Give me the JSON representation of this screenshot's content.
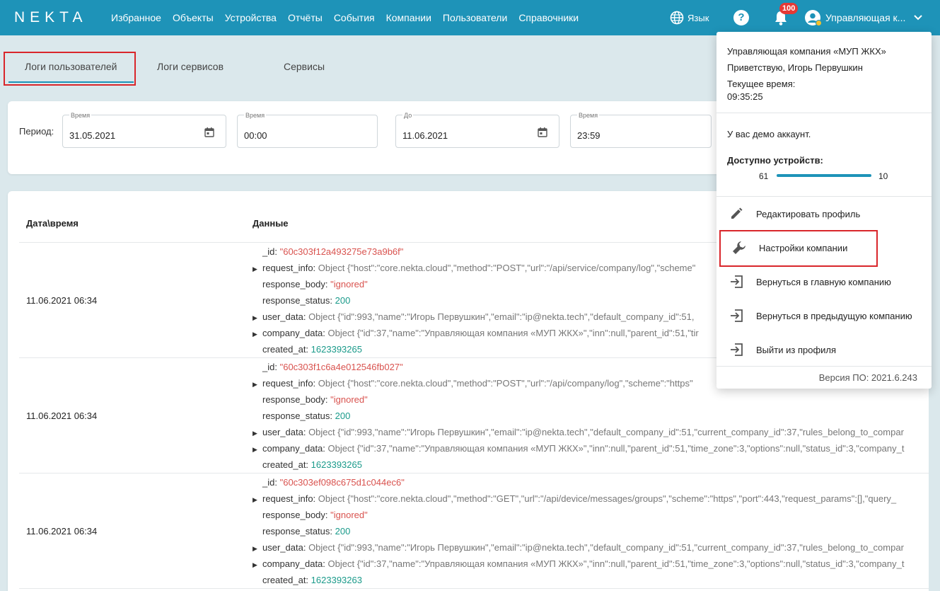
{
  "app": {
    "logo": "NEKTA",
    "nav": [
      "Избранное",
      "Объекты",
      "Устройства",
      "Отчёты",
      "События",
      "Компании",
      "Пользователи",
      "Справочники"
    ],
    "language_label": "Язык",
    "help_label": "?",
    "notifications_count": "100",
    "user_label": "Управляющая к..."
  },
  "tabs": [
    {
      "label": "Логи пользователей",
      "active": true
    },
    {
      "label": "Логи сервисов",
      "active": false
    },
    {
      "label": "Сервисы",
      "active": false
    }
  ],
  "filter": {
    "period_label": "Период:",
    "fields": [
      {
        "label": "Время",
        "value": "31.05.2021"
      },
      {
        "label": "Время",
        "value": "00:00"
      },
      {
        "label": "До",
        "value": "11.06.2021"
      },
      {
        "label": "Время",
        "value": "23:59"
      }
    ]
  },
  "table": {
    "headers": [
      "Дата\\время",
      "Данные"
    ],
    "rows": [
      {
        "date": "11.06.2021 06:34",
        "lines": [
          {
            "key": "_id:",
            "val": "\"60c303f12a493275e73a9b6f\"",
            "kind": "red",
            "arrow": false
          },
          {
            "key": "request_info:",
            "val": "Object {\"host\":\"core.nekta.cloud\",\"method\":\"POST\",\"url\":\"/api/service/company/log\",\"scheme\"",
            "kind": "grey",
            "arrow": true
          },
          {
            "key": "response_body:",
            "val": "\"ignored\"",
            "kind": "red",
            "arrow": false
          },
          {
            "key": "response_status:",
            "val": "200",
            "kind": "teal",
            "arrow": false
          },
          {
            "key": "user_data:",
            "val": "Object {\"id\":993,\"name\":\"Игорь Первушкин\",\"email\":\"ip@nekta.tech\",\"default_company_id\":51,",
            "kind": "grey",
            "arrow": true
          },
          {
            "key": "company_data:",
            "val": "Object {\"id\":37,\"name\":\"Управляющая компания «МУП ЖКХ»\",\"inn\":null,\"parent_id\":51,\"tir",
            "kind": "grey",
            "arrow": true
          },
          {
            "key": "created_at:",
            "val": "1623393265",
            "kind": "teal",
            "arrow": false
          }
        ]
      },
      {
        "date": "11.06.2021 06:34",
        "lines": [
          {
            "key": "_id:",
            "val": "\"60c303f1c6a4e012546fb027\"",
            "kind": "red",
            "arrow": false
          },
          {
            "key": "request_info:",
            "val": "Object {\"host\":\"core.nekta.cloud\",\"method\":\"POST\",\"url\":\"/api/company/log\",\"scheme\":\"https\"",
            "kind": "grey",
            "arrow": true
          },
          {
            "key": "response_body:",
            "val": "\"ignored\"",
            "kind": "red",
            "arrow": false
          },
          {
            "key": "response_status:",
            "val": "200",
            "kind": "teal",
            "arrow": false
          },
          {
            "key": "user_data:",
            "val": "Object {\"id\":993,\"name\":\"Игорь Первушкин\",\"email\":\"ip@nekta.tech\",\"default_company_id\":51,\"current_company_id\":37,\"rules_belong_to_compar",
            "kind": "grey",
            "arrow": true
          },
          {
            "key": "company_data:",
            "val": "Object {\"id\":37,\"name\":\"Управляющая компания «МУП ЖКХ»\",\"inn\":null,\"parent_id\":51,\"time_zone\":3,\"options\":null,\"status_id\":3,\"company_t",
            "kind": "grey",
            "arrow": true
          },
          {
            "key": "created_at:",
            "val": "1623393265",
            "kind": "teal",
            "arrow": false
          }
        ]
      },
      {
        "date": "11.06.2021 06:34",
        "lines": [
          {
            "key": "_id:",
            "val": "\"60c303ef098c675d1c044ec6\"",
            "kind": "red",
            "arrow": false
          },
          {
            "key": "request_info:",
            "val": "Object {\"host\":\"core.nekta.cloud\",\"method\":\"GET\",\"url\":\"/api/device/messages/groups\",\"scheme\":\"https\",\"port\":443,\"request_params\":[],\"query_",
            "kind": "grey",
            "arrow": true
          },
          {
            "key": "response_body:",
            "val": "\"ignored\"",
            "kind": "red",
            "arrow": false
          },
          {
            "key": "response_status:",
            "val": "200",
            "kind": "teal",
            "arrow": false
          },
          {
            "key": "user_data:",
            "val": "Object {\"id\":993,\"name\":\"Игорь Первушкин\",\"email\":\"ip@nekta.tech\",\"default_company_id\":51,\"current_company_id\":37,\"rules_belong_to_compar",
            "kind": "grey",
            "arrow": true
          },
          {
            "key": "company_data:",
            "val": "Object {\"id\":37,\"name\":\"Управляющая компания «МУП ЖКХ»\",\"inn\":null,\"parent_id\":51,\"time_zone\":3,\"options\":null,\"status_id\":3,\"company_t",
            "kind": "grey",
            "arrow": true
          },
          {
            "key": "created_at:",
            "val": "1623393263",
            "kind": "teal",
            "arrow": false
          }
        ]
      }
    ]
  },
  "profile_menu": {
    "company": "Управляющая компания «МУП ЖКХ»",
    "greeting": "Приветствую, Игорь Первушкин",
    "time_label": "Текущее время:",
    "time_value": "09:35:25",
    "demo_note": "У вас демо аккаунт.",
    "devices_label": "Доступно устройств:",
    "devices_left": "61",
    "devices_right": "10",
    "items": [
      {
        "label": "Редактировать профиль",
        "icon": "pencil-icon"
      },
      {
        "label": "Настройки компании",
        "icon": "wrench-icon"
      },
      {
        "label": "Вернуться в главную компанию",
        "icon": "enter-icon"
      },
      {
        "label": "Вернуться в предыдущую компанию",
        "icon": "enter-icon"
      },
      {
        "label": "Выйти из профиля",
        "icon": "enter-icon"
      }
    ],
    "version": "Версия ПО: 2021.6.243"
  },
  "colors": {
    "accent": "#1e93b8",
    "highlight": "#d9262b"
  }
}
